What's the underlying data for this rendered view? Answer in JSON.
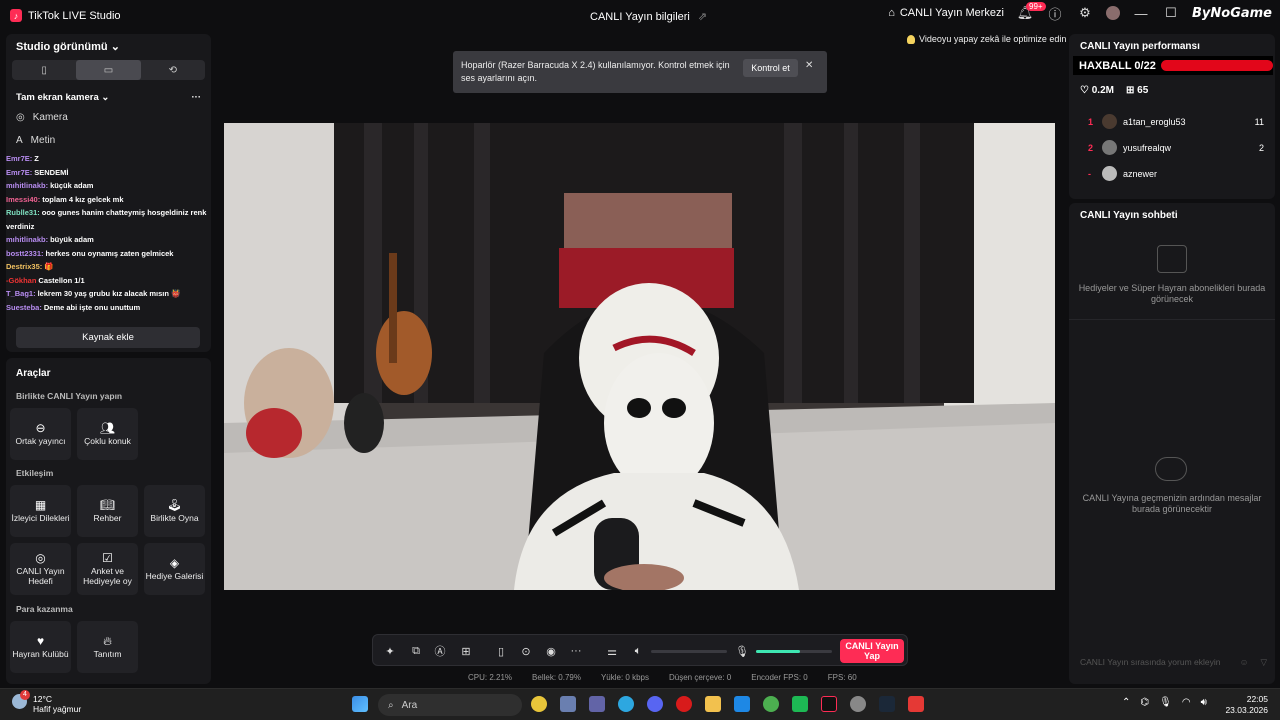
{
  "titlebar": {
    "app_name": "TikTok LIVE Studio",
    "stream_info": "CANLI Yayın bilgileri",
    "live_center": "CANLI Yayın Merkezi",
    "notification_count": "99+",
    "watermark": "ByNoGame"
  },
  "left": {
    "studio_view": "Studio görünümü",
    "camera_mode": "Tam ekran kamera",
    "sources": [
      {
        "icon": "camera-icon",
        "label": "Kamera"
      },
      {
        "icon": "text-icon",
        "label": "Metin"
      }
    ],
    "chat": [
      {
        "user": "Emr7E:",
        "msg": "Z",
        "color": "#b78cf0"
      },
      {
        "user": "Emr7E:",
        "msg": "SENDEMİ",
        "color": "#b78cf0"
      },
      {
        "user": "mıhitlinakb:",
        "msg": "küçük adam",
        "color": "#b78cf0"
      },
      {
        "user": "Imessi40:",
        "msg": "toplam 4 kız gelcek mk",
        "color": "#f06292"
      },
      {
        "user": "Rublle31:",
        "msg": "ooo gunes hanim chatteymiş hosgeldiniz renk verdiniz",
        "color": "#7ee0c0"
      },
      {
        "user": "mıhitlinakb:",
        "msg": "büyük adam",
        "color": "#b78cf0"
      },
      {
        "user": "bostt2331:",
        "msg": "herkes onu oynamış zaten gelmicek",
        "color": "#b78cf0"
      },
      {
        "user": "Destrix35:",
        "msg": "🎁",
        "color": "#f0c060"
      },
      {
        "user": "-Gökhan",
        "msg": "Castellon 1/1",
        "color": "#e33"
      },
      {
        "user": "T_Bag1:",
        "msg": "lekrem 30 yaş grubu kız alacak mısın 👹",
        "color": "#b78cf0"
      },
      {
        "user": "Suesteba:",
        "msg": "Deme abi işte onu unuttum",
        "color": "#b78cf0"
      }
    ],
    "add_source": "Kaynak ekle",
    "tools_title": "Araçlar",
    "section_collab": "Birlikte CANLI Yayın yapın",
    "section_engage": "Etkileşim",
    "section_earn": "Para kazanma",
    "tools": {
      "cohost": "Ortak yayıncı",
      "multi_guest": "Çoklu konuk",
      "viewer_requests": "İzleyici Dilekleri",
      "guide": "Rehber",
      "play_together": "Birlikte Oyna",
      "live_goal": "CANLI Yayın Hedefi",
      "poll": "Anket ve Hediyeyle oy",
      "gift_gallery": "Hediye Galerisi",
      "fan_club": "Hayran Kulübü",
      "promote": "Tanıtım"
    }
  },
  "center": {
    "notice_text": "Hoparlör (Razer Barracuda X 2.4) kullanılamıyor. Kontrol etmek için ses ayarlarını açın.",
    "notice_button": "Kontrol et",
    "ai_optimize": "Videoyu yapay zekâ ile optimize edin",
    "go_live": "CANLI Yayın Yap",
    "speaker_level": 0,
    "mic_level": 0.58,
    "stats": {
      "cpu": "CPU:  2.21%",
      "memory": "Bellek:  0.79%",
      "upload": "Yükle:  0 kbps",
      "dropped": "Düşen çerçeve:  0",
      "encoder": "Encoder FPS:  0",
      "fps": "FPS:  60"
    }
  },
  "right": {
    "performance_title": "CANLI Yayın performansı",
    "haxball": "HAXBALL 0/22",
    "likes": "0.2M",
    "gifts": "65",
    "ranking": [
      {
        "rank": "1",
        "name": "a1tan_eroglu53",
        "score": "11"
      },
      {
        "rank": "2",
        "name": "yusufrealqw",
        "score": "2"
      },
      {
        "rank": "-",
        "name": "aznewer",
        "score": ""
      }
    ],
    "chat_title": "CANLI Yayın sohbeti",
    "gifts_empty": "Hediyeler ve Süper Hayran abonelikleri burada görünecek",
    "chat_empty": "CANLI Yayına geçmenizin ardından mesajlar burada görünecektir",
    "comment_placeholder": "CANLI Yayın sırasında yorum ekleyin"
  },
  "taskbar": {
    "temp": "12°C",
    "weather": "Hafif yağmur",
    "weather_badge": "4",
    "search": "Ara",
    "time": "22:05",
    "date": "23.03.2026"
  },
  "colors": {
    "accent": "#fe2c55",
    "panel": "#18181b",
    "haxball_bar": "#e2061a"
  }
}
